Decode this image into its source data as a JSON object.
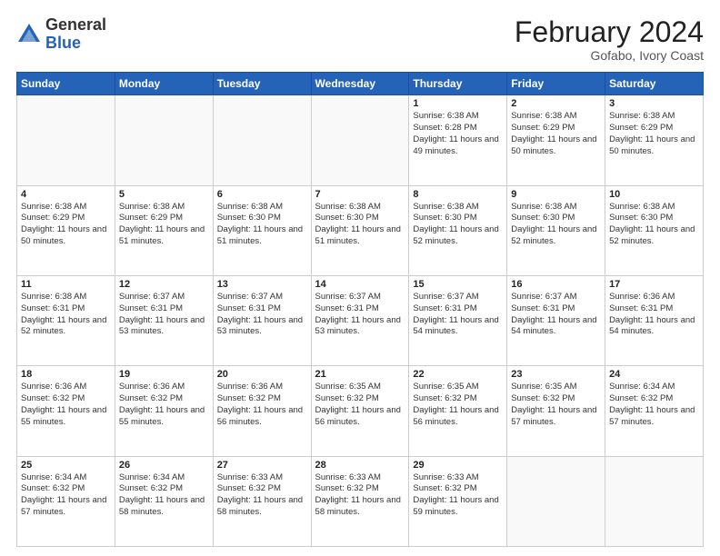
{
  "header": {
    "logo_general": "General",
    "logo_blue": "Blue",
    "month_year": "February 2024",
    "location": "Gofabo, Ivory Coast"
  },
  "days_of_week": [
    "Sunday",
    "Monday",
    "Tuesday",
    "Wednesday",
    "Thursday",
    "Friday",
    "Saturday"
  ],
  "weeks": [
    [
      {
        "num": "",
        "info": ""
      },
      {
        "num": "",
        "info": ""
      },
      {
        "num": "",
        "info": ""
      },
      {
        "num": "",
        "info": ""
      },
      {
        "num": "1",
        "info": "Sunrise: 6:38 AM\nSunset: 6:28 PM\nDaylight: 11 hours\nand 49 minutes."
      },
      {
        "num": "2",
        "info": "Sunrise: 6:38 AM\nSunset: 6:29 PM\nDaylight: 11 hours\nand 50 minutes."
      },
      {
        "num": "3",
        "info": "Sunrise: 6:38 AM\nSunset: 6:29 PM\nDaylight: 11 hours\nand 50 minutes."
      }
    ],
    [
      {
        "num": "4",
        "info": "Sunrise: 6:38 AM\nSunset: 6:29 PM\nDaylight: 11 hours\nand 50 minutes."
      },
      {
        "num": "5",
        "info": "Sunrise: 6:38 AM\nSunset: 6:29 PM\nDaylight: 11 hours\nand 51 minutes."
      },
      {
        "num": "6",
        "info": "Sunrise: 6:38 AM\nSunset: 6:30 PM\nDaylight: 11 hours\nand 51 minutes."
      },
      {
        "num": "7",
        "info": "Sunrise: 6:38 AM\nSunset: 6:30 PM\nDaylight: 11 hours\nand 51 minutes."
      },
      {
        "num": "8",
        "info": "Sunrise: 6:38 AM\nSunset: 6:30 PM\nDaylight: 11 hours\nand 52 minutes."
      },
      {
        "num": "9",
        "info": "Sunrise: 6:38 AM\nSunset: 6:30 PM\nDaylight: 11 hours\nand 52 minutes."
      },
      {
        "num": "10",
        "info": "Sunrise: 6:38 AM\nSunset: 6:30 PM\nDaylight: 11 hours\nand 52 minutes."
      }
    ],
    [
      {
        "num": "11",
        "info": "Sunrise: 6:38 AM\nSunset: 6:31 PM\nDaylight: 11 hours\nand 52 minutes."
      },
      {
        "num": "12",
        "info": "Sunrise: 6:37 AM\nSunset: 6:31 PM\nDaylight: 11 hours\nand 53 minutes."
      },
      {
        "num": "13",
        "info": "Sunrise: 6:37 AM\nSunset: 6:31 PM\nDaylight: 11 hours\nand 53 minutes."
      },
      {
        "num": "14",
        "info": "Sunrise: 6:37 AM\nSunset: 6:31 PM\nDaylight: 11 hours\nand 53 minutes."
      },
      {
        "num": "15",
        "info": "Sunrise: 6:37 AM\nSunset: 6:31 PM\nDaylight: 11 hours\nand 54 minutes."
      },
      {
        "num": "16",
        "info": "Sunrise: 6:37 AM\nSunset: 6:31 PM\nDaylight: 11 hours\nand 54 minutes."
      },
      {
        "num": "17",
        "info": "Sunrise: 6:36 AM\nSunset: 6:31 PM\nDaylight: 11 hours\nand 54 minutes."
      }
    ],
    [
      {
        "num": "18",
        "info": "Sunrise: 6:36 AM\nSunset: 6:32 PM\nDaylight: 11 hours\nand 55 minutes."
      },
      {
        "num": "19",
        "info": "Sunrise: 6:36 AM\nSunset: 6:32 PM\nDaylight: 11 hours\nand 55 minutes."
      },
      {
        "num": "20",
        "info": "Sunrise: 6:36 AM\nSunset: 6:32 PM\nDaylight: 11 hours\nand 56 minutes."
      },
      {
        "num": "21",
        "info": "Sunrise: 6:35 AM\nSunset: 6:32 PM\nDaylight: 11 hours\nand 56 minutes."
      },
      {
        "num": "22",
        "info": "Sunrise: 6:35 AM\nSunset: 6:32 PM\nDaylight: 11 hours\nand 56 minutes."
      },
      {
        "num": "23",
        "info": "Sunrise: 6:35 AM\nSunset: 6:32 PM\nDaylight: 11 hours\nand 57 minutes."
      },
      {
        "num": "24",
        "info": "Sunrise: 6:34 AM\nSunset: 6:32 PM\nDaylight: 11 hours\nand 57 minutes."
      }
    ],
    [
      {
        "num": "25",
        "info": "Sunrise: 6:34 AM\nSunset: 6:32 PM\nDaylight: 11 hours\nand 57 minutes."
      },
      {
        "num": "26",
        "info": "Sunrise: 6:34 AM\nSunset: 6:32 PM\nDaylight: 11 hours\nand 58 minutes."
      },
      {
        "num": "27",
        "info": "Sunrise: 6:33 AM\nSunset: 6:32 PM\nDaylight: 11 hours\nand 58 minutes."
      },
      {
        "num": "28",
        "info": "Sunrise: 6:33 AM\nSunset: 6:32 PM\nDaylight: 11 hours\nand 58 minutes."
      },
      {
        "num": "29",
        "info": "Sunrise: 6:33 AM\nSunset: 6:32 PM\nDaylight: 11 hours\nand 59 minutes."
      },
      {
        "num": "",
        "info": ""
      },
      {
        "num": "",
        "info": ""
      }
    ]
  ]
}
